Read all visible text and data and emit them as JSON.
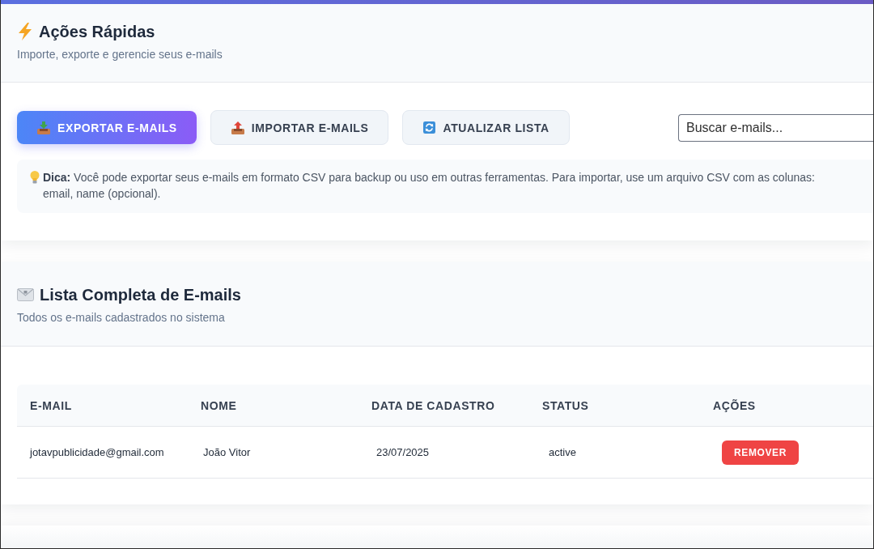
{
  "quick_actions": {
    "title": "Ações Rápidas",
    "subtitle": "Importe, exporte e gerencie seus e-mails",
    "buttons": [
      {
        "kind": "export",
        "label": "EXPORTAR E-MAILS",
        "primary": true
      },
      {
        "kind": "import",
        "label": "IMPORTAR E-MAILS",
        "primary": false
      },
      {
        "kind": "refresh",
        "label": "ATUALIZAR LISTA",
        "primary": false
      }
    ],
    "search": {
      "placeholder": "Buscar e-mails..."
    },
    "tip": "**Dica:** Você pode exportar seus e-mails em formato CSV para backup ou uso em outras ferramentas. Para importar, use um arquivo CSV com as colunas: email, name (opcional)."
  },
  "email_list": {
    "title": "Lista Completa de E-mails",
    "subtitle": "Todos os e-mails cadastrados no sistema",
    "table": {
      "columns": [
        "E-MAIL",
        "NOME",
        "DATA DE CADASTRO",
        "STATUS",
        "AÇÕES"
      ],
      "rows": [
        {
          "email": "jotavpublicidade@gmail.com",
          "name": "João Vitor",
          "date": "23/07/2025",
          "status": "active",
          "action": "REMOVER"
        }
      ]
    }
  }
}
